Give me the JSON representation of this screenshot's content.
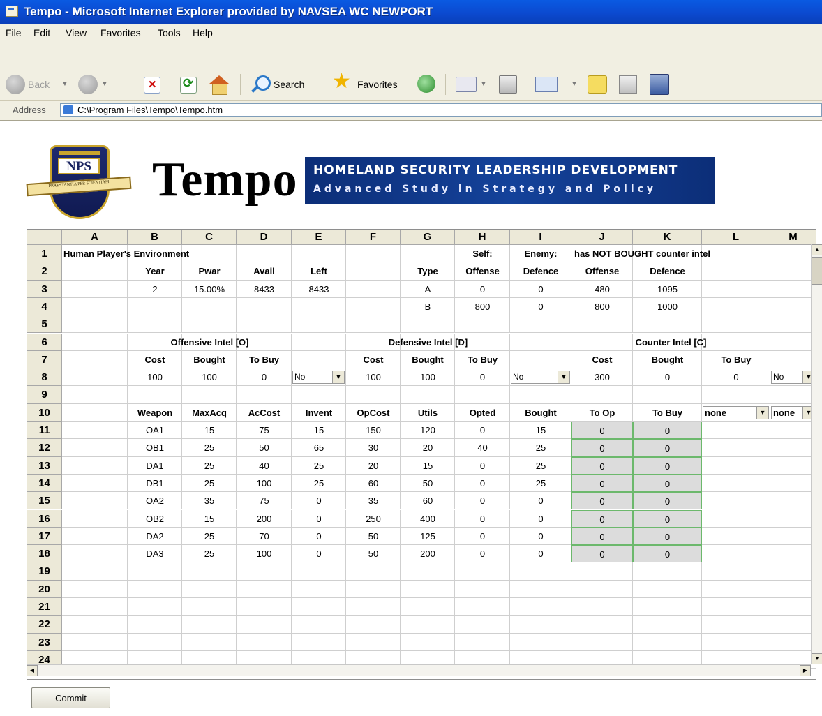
{
  "window": {
    "title": "Tempo - Microsoft Internet Explorer provided by NAVSEA WC NEWPORT"
  },
  "menu": [
    "File",
    "Edit",
    "View",
    "Favorites",
    "Tools",
    "Help"
  ],
  "toolbar": {
    "back_label": "Back",
    "search_label": "Search",
    "favorites_label": "Favorites"
  },
  "address": {
    "label": "Address",
    "url": "C:\\Program Files\\Tempo\\Tempo.htm"
  },
  "header": {
    "crest_text": "NPS",
    "crest_motto": "PRAESTANTIA PER SCIENTIAM",
    "app_name": "Tempo",
    "banner_line1": "HOMELAND SECURITY LEADERSHIP DEVELOPMENT",
    "banner_line2": "Advanced Study in Strategy and Policy"
  },
  "grid": {
    "columns": [
      "A",
      "B",
      "C",
      "D",
      "E",
      "F",
      "G",
      "H",
      "I",
      "J",
      "K",
      "L",
      "M"
    ],
    "row_numbers": [
      "1",
      "2",
      "3",
      "4",
      "5",
      "6",
      "7",
      "8",
      "9",
      "10",
      "11",
      "12",
      "13",
      "14",
      "15",
      "16",
      "17",
      "18",
      "19",
      "20",
      "21",
      "22",
      "23",
      "24"
    ],
    "row1": {
      "env_title": "Human Player's Environment",
      "self_label": "Self:",
      "enemy_label": "Enemy:",
      "enemy_status": "has NOT BOUGHT counter intel"
    },
    "row2": [
      "Year",
      "Pwar",
      "Avail",
      "Left",
      "",
      "Type",
      "Offense",
      "Defence",
      "Offense",
      "Defence"
    ],
    "row3": [
      "2",
      "15.00%",
      "8433",
      "8433",
      "",
      "A",
      "0",
      "0",
      "480",
      "1095"
    ],
    "row4": [
      "",
      "",
      "",
      "",
      "",
      "B",
      "800",
      "0",
      "800",
      "1000"
    ],
    "row6": {
      "offensive": "Offensive Intel [O]",
      "defensive": "Defensive Intel [D]",
      "counter": "Counter Intel [C]"
    },
    "row7": [
      "Cost",
      "Bought",
      "To Buy",
      "",
      "Cost",
      "Bought",
      "To Buy",
      "",
      "Cost",
      "Bought",
      "To Buy"
    ],
    "row8": [
      "100",
      "100",
      "0",
      "",
      "100",
      "100",
      "0",
      "",
      "300",
      "0",
      "0"
    ],
    "row8_selects": [
      "No",
      "No",
      "No"
    ],
    "row10": [
      "Weapon",
      "MaxAcq",
      "AcCost",
      "Invent",
      "OpCost",
      "Utils",
      "Opted",
      "Bought",
      "To Op",
      "To Buy"
    ],
    "row10_selects": [
      "none",
      "none"
    ],
    "weapons": [
      [
        "OA1",
        "15",
        "75",
        "15",
        "150",
        "120",
        "0",
        "15",
        "0",
        "0"
      ],
      [
        "OB1",
        "25",
        "50",
        "65",
        "30",
        "20",
        "40",
        "25",
        "0",
        "0"
      ],
      [
        "DA1",
        "25",
        "40",
        "25",
        "20",
        "15",
        "0",
        "25",
        "0",
        "0"
      ],
      [
        "DB1",
        "25",
        "100",
        "25",
        "60",
        "50",
        "0",
        "25",
        "0",
        "0"
      ],
      [
        "OA2",
        "35",
        "75",
        "0",
        "35",
        "60",
        "0",
        "0",
        "0",
        "0"
      ],
      [
        "OB2",
        "15",
        "200",
        "0",
        "250",
        "400",
        "0",
        "0",
        "0",
        "0"
      ],
      [
        "DA2",
        "25",
        "70",
        "0",
        "50",
        "125",
        "0",
        "0",
        "0",
        "0"
      ],
      [
        "DA3",
        "25",
        "100",
        "0",
        "50",
        "200",
        "0",
        "0",
        "0",
        "0"
      ]
    ]
  },
  "commit_label": "Commit"
}
